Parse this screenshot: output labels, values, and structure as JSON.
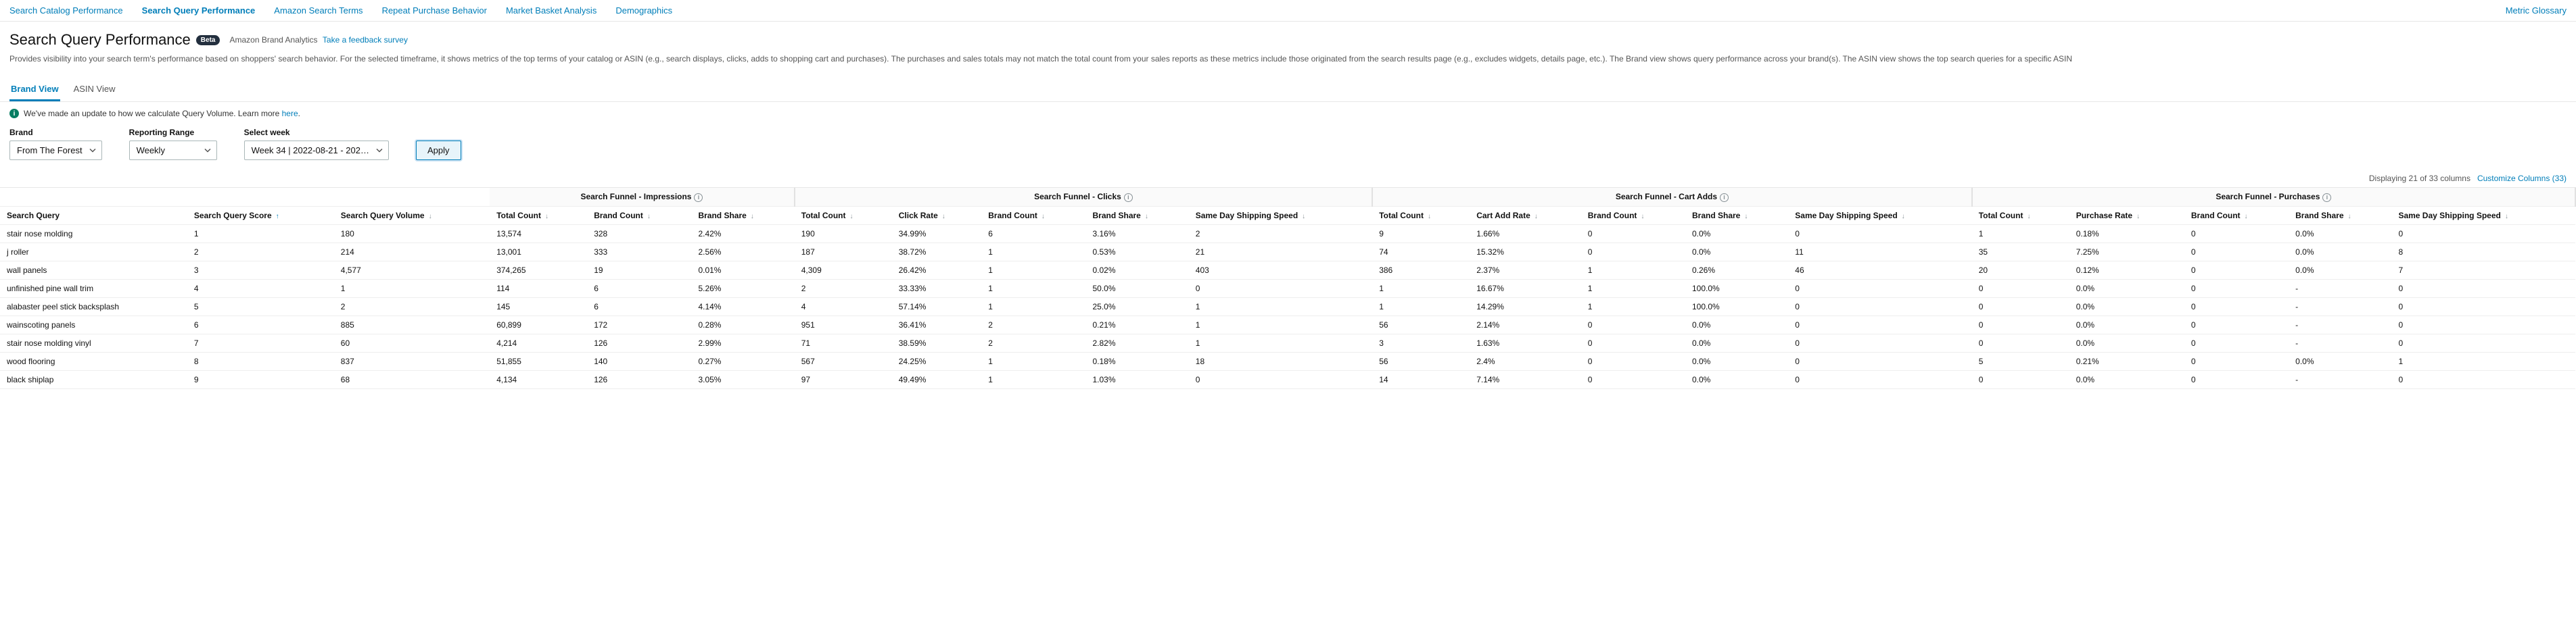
{
  "top_nav": {
    "items": [
      {
        "label": "Search Catalog Performance",
        "active": false
      },
      {
        "label": "Search Query Performance",
        "active": true
      },
      {
        "label": "Amazon Search Terms",
        "active": false
      },
      {
        "label": "Repeat Purchase Behavior",
        "active": false
      },
      {
        "label": "Market Basket Analysis",
        "active": false
      },
      {
        "label": "Demographics",
        "active": false
      }
    ],
    "metric_glossary": "Metric Glossary"
  },
  "header": {
    "title": "Search Query Performance",
    "beta": "Beta",
    "breadcrumb_text": "Amazon Brand Analytics",
    "feedback_link": "Take a feedback survey",
    "description": "Provides visibility into your search term's performance based on shoppers' search behavior. For the selected timeframe, it shows metrics of the top terms of your catalog or ASIN (e.g., search displays, clicks, adds to shopping cart and purchases). The purchases and sales totals may not match the total count from your sales reports as these metrics include those originated from the search results page (e.g., excludes widgets, details page, etc.). The Brand view shows query performance across your brand(s). The ASIN view shows the top search queries for a specific ASIN"
  },
  "view_tabs": {
    "brand": "Brand View",
    "asin": "ASIN View"
  },
  "banner": {
    "text": "We've made an update to how we calculate Query Volume. Learn more ",
    "link": "here"
  },
  "filters": {
    "brand_label": "Brand",
    "brand_value": "From The Forest",
    "range_label": "Reporting Range",
    "range_value": "Weekly",
    "week_label": "Select week",
    "week_value": "Week 34 | 2022-08-21 - 202…",
    "apply": "Apply"
  },
  "columns_meta": {
    "display_text": "Displaying 21 of 33 columns",
    "customize": "Customize Columns (33)"
  },
  "groups": {
    "impressions": "Search Funnel - Impressions",
    "clicks": "Search Funnel - Clicks",
    "cart_adds": "Search Funnel - Cart Adds",
    "purchases": "Search Funnel - Purchases"
  },
  "columns": {
    "search_query": "Search Query",
    "sq_score": "Search Query Score",
    "sq_volume": "Search Query Volume",
    "total_count": "Total Count",
    "brand_count": "Brand Count",
    "brand_share": "Brand Share",
    "click_rate": "Click Rate",
    "cart_add_rate": "Cart Add Rate",
    "purchase_rate": "Purchase Rate",
    "same_day": "Same Day Shipping Speed"
  },
  "rows": [
    {
      "q": "stair nose molding",
      "score": "1",
      "vol": "180",
      "imp_tc": "13,574",
      "imp_bc": "328",
      "imp_bs": "2.42%",
      "clk_tc": "190",
      "clk_rate": "34.99%",
      "clk_bc": "6",
      "clk_bs": "3.16%",
      "clk_sd": "2",
      "ca_tc": "9",
      "ca_rate": "1.66%",
      "ca_bc": "0",
      "ca_bs": "0.0%",
      "ca_sd": "0",
      "p_tc": "1",
      "p_rate": "0.18%",
      "p_bc": "0",
      "p_bs": "0.0%",
      "p_sd": "0"
    },
    {
      "q": "j roller",
      "score": "2",
      "vol": "214",
      "imp_tc": "13,001",
      "imp_bc": "333",
      "imp_bs": "2.56%",
      "clk_tc": "187",
      "clk_rate": "38.72%",
      "clk_bc": "1",
      "clk_bs": "0.53%",
      "clk_sd": "21",
      "ca_tc": "74",
      "ca_rate": "15.32%",
      "ca_bc": "0",
      "ca_bs": "0.0%",
      "ca_sd": "11",
      "p_tc": "35",
      "p_rate": "7.25%",
      "p_bc": "0",
      "p_bs": "0.0%",
      "p_sd": "8"
    },
    {
      "q": "wall panels",
      "score": "3",
      "vol": "4,577",
      "imp_tc": "374,265",
      "imp_bc": "19",
      "imp_bs": "0.01%",
      "clk_tc": "4,309",
      "clk_rate": "26.42%",
      "clk_bc": "1",
      "clk_bs": "0.02%",
      "clk_sd": "403",
      "ca_tc": "386",
      "ca_rate": "2.37%",
      "ca_bc": "1",
      "ca_bs": "0.26%",
      "ca_sd": "46",
      "p_tc": "20",
      "p_rate": "0.12%",
      "p_bc": "0",
      "p_bs": "0.0%",
      "p_sd": "7"
    },
    {
      "q": "unfinished pine wall trim",
      "score": "4",
      "vol": "1",
      "imp_tc": "114",
      "imp_bc": "6",
      "imp_bs": "5.26%",
      "clk_tc": "2",
      "clk_rate": "33.33%",
      "clk_bc": "1",
      "clk_bs": "50.0%",
      "clk_sd": "0",
      "ca_tc": "1",
      "ca_rate": "16.67%",
      "ca_bc": "1",
      "ca_bs": "100.0%",
      "ca_sd": "0",
      "p_tc": "0",
      "p_rate": "0.0%",
      "p_bc": "0",
      "p_bs": "-",
      "p_sd": "0"
    },
    {
      "q": "alabaster peel stick backsplash",
      "score": "5",
      "vol": "2",
      "imp_tc": "145",
      "imp_bc": "6",
      "imp_bs": "4.14%",
      "clk_tc": "4",
      "clk_rate": "57.14%",
      "clk_bc": "1",
      "clk_bs": "25.0%",
      "clk_sd": "1",
      "ca_tc": "1",
      "ca_rate": "14.29%",
      "ca_bc": "1",
      "ca_bs": "100.0%",
      "ca_sd": "0",
      "p_tc": "0",
      "p_rate": "0.0%",
      "p_bc": "0",
      "p_bs": "-",
      "p_sd": "0"
    },
    {
      "q": "wainscoting panels",
      "score": "6",
      "vol": "885",
      "imp_tc": "60,899",
      "imp_bc": "172",
      "imp_bs": "0.28%",
      "clk_tc": "951",
      "clk_rate": "36.41%",
      "clk_bc": "2",
      "clk_bs": "0.21%",
      "clk_sd": "1",
      "ca_tc": "56",
      "ca_rate": "2.14%",
      "ca_bc": "0",
      "ca_bs": "0.0%",
      "ca_sd": "0",
      "p_tc": "0",
      "p_rate": "0.0%",
      "p_bc": "0",
      "p_bs": "-",
      "p_sd": "0"
    },
    {
      "q": "stair nose molding vinyl",
      "score": "7",
      "vol": "60",
      "imp_tc": "4,214",
      "imp_bc": "126",
      "imp_bs": "2.99%",
      "clk_tc": "71",
      "clk_rate": "38.59%",
      "clk_bc": "2",
      "clk_bs": "2.82%",
      "clk_sd": "1",
      "ca_tc": "3",
      "ca_rate": "1.63%",
      "ca_bc": "0",
      "ca_bs": "0.0%",
      "ca_sd": "0",
      "p_tc": "0",
      "p_rate": "0.0%",
      "p_bc": "0",
      "p_bs": "-",
      "p_sd": "0"
    },
    {
      "q": "wood flooring",
      "score": "8",
      "vol": "837",
      "imp_tc": "51,855",
      "imp_bc": "140",
      "imp_bs": "0.27%",
      "clk_tc": "567",
      "clk_rate": "24.25%",
      "clk_bc": "1",
      "clk_bs": "0.18%",
      "clk_sd": "18",
      "ca_tc": "56",
      "ca_rate": "2.4%",
      "ca_bc": "0",
      "ca_bs": "0.0%",
      "ca_sd": "0",
      "p_tc": "5",
      "p_rate": "0.21%",
      "p_bc": "0",
      "p_bs": "0.0%",
      "p_sd": "1"
    },
    {
      "q": "black shiplap",
      "score": "9",
      "vol": "68",
      "imp_tc": "4,134",
      "imp_bc": "126",
      "imp_bs": "3.05%",
      "clk_tc": "97",
      "clk_rate": "49.49%",
      "clk_bc": "1",
      "clk_bs": "1.03%",
      "clk_sd": "0",
      "ca_tc": "14",
      "ca_rate": "7.14%",
      "ca_bc": "0",
      "ca_bs": "0.0%",
      "ca_sd": "0",
      "p_tc": "0",
      "p_rate": "0.0%",
      "p_bc": "0",
      "p_bs": "-",
      "p_sd": "0"
    }
  ]
}
